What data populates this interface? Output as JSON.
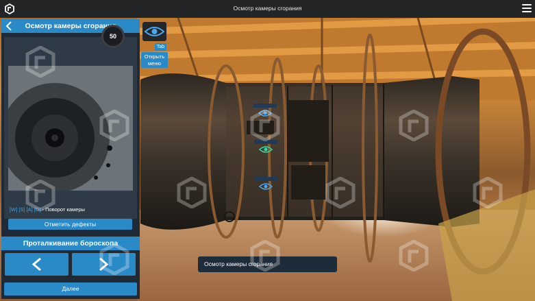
{
  "topbar": {
    "title": "Осмотр камеры сгорания"
  },
  "panel": {
    "title": "Осмотр камеры сгорания",
    "counter": "50",
    "hint_keys": "[W] [S] [A] [D]",
    "hint_text": " - Поворот камеры",
    "mark_defects": "Отметить дефекты",
    "boroscope_title": "Проталкивание бороскопа",
    "next_label": "Далее"
  },
  "view_toggle": {
    "tab_key": "Tab",
    "open_menu": "Открыть меню"
  },
  "caption": "Осмотр камеры сгорания",
  "colors": {
    "accent": "#2a89c7",
    "panel_bg": "#1f2a36",
    "marker_active": "#2ee0a8"
  }
}
